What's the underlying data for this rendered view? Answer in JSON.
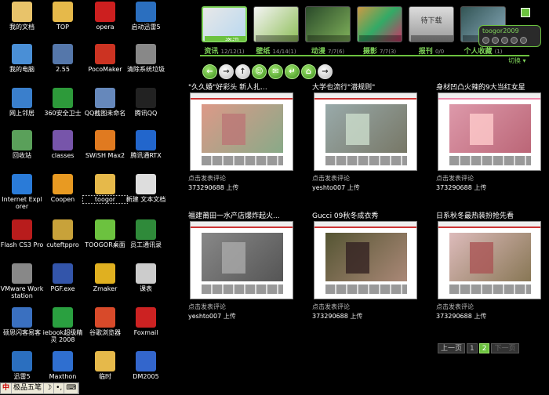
{
  "desktop": {
    "icons": [
      {
        "label": "我的文档",
        "icon": "my-documents-icon",
        "color": "#e8c36a"
      },
      {
        "label": "TOP",
        "icon": "folder-icon",
        "color": "#e6b94a"
      },
      {
        "label": "opera",
        "icon": "opera-icon",
        "color": "#cc1f1f"
      },
      {
        "label": "启动迅雷5",
        "icon": "thunder-icon",
        "color": "#2b6fbf"
      },
      {
        "label": "我的电脑",
        "icon": "my-computer-icon",
        "color": "#4a8fd6"
      },
      {
        "label": "2.55",
        "icon": "network-icon",
        "color": "#5577aa"
      },
      {
        "label": "PocoMaker",
        "icon": "pocomaker-icon",
        "color": "#cc3322"
      },
      {
        "label": "清除系统垃圾",
        "icon": "cleaner-icon",
        "color": "#888888"
      },
      {
        "label": "网上邻居",
        "icon": "network-places-icon",
        "color": "#3a7fcc"
      },
      {
        "label": "360安全卫士",
        "icon": "security-360-icon",
        "color": "#2d9a3a"
      },
      {
        "label": "QQ截图未命名",
        "icon": "qq-screenshot-icon",
        "color": "#6688bb"
      },
      {
        "label": "腾讯QQ",
        "icon": "qq-penguin-icon",
        "color": "#222222"
      },
      {
        "label": "回收站",
        "icon": "recycle-bin-icon",
        "color": "#5aa05a"
      },
      {
        "label": "classes",
        "icon": "archive-icon",
        "color": "#7755aa"
      },
      {
        "label": "SWiSH Max2",
        "icon": "swish-icon",
        "color": "#e07a20"
      },
      {
        "label": "腾讯通RTX",
        "icon": "rtx-icon",
        "color": "#2266cc"
      },
      {
        "label": "Internet Explorer",
        "icon": "ie-icon",
        "color": "#2a7bd8"
      },
      {
        "label": "Coopen",
        "icon": "coopen-icon",
        "color": "#e89a22"
      },
      {
        "label": "toogor",
        "icon": "folder-icon",
        "color": "#e6b94a"
      },
      {
        "label": "新建 文本文档",
        "icon": "text-file-icon",
        "color": "#dddddd"
      },
      {
        "label": "Flash CS3 Pro",
        "icon": "flash-icon",
        "color": "#b81c1c"
      },
      {
        "label": "cuteftppro",
        "icon": "ftp-icon",
        "color": "#c8a23a"
      },
      {
        "label": "TOOGOR桌面",
        "icon": "toogor-icon",
        "color": "#6cc23f"
      },
      {
        "label": "员工通讯录",
        "icon": "excel-icon",
        "color": "#2f8a3a"
      },
      {
        "label": "VMware Workstation",
        "icon": "vmware-icon",
        "color": "#888888"
      },
      {
        "label": "PGF.exe",
        "icon": "exe-icon",
        "color": "#3355aa"
      },
      {
        "label": "Zmaker",
        "icon": "zmaker-icon",
        "color": "#e0b020"
      },
      {
        "label": "课表",
        "icon": "document-icon",
        "color": "#cccccc"
      },
      {
        "label": "硕思闪客易客",
        "icon": "sothink-icon",
        "color": "#3a70c0"
      },
      {
        "label": "iebook超级精灵 2008",
        "icon": "iebook-icon",
        "color": "#2aa040"
      },
      {
        "label": "谷歌浏览器",
        "icon": "chrome-icon",
        "color": "#d84a2a"
      },
      {
        "label": "Foxmail",
        "icon": "foxmail-icon",
        "color": "#cc2222"
      },
      {
        "label": "迅雷5",
        "icon": "thunder-icon",
        "color": "#2b6fbf"
      },
      {
        "label": "Maxthon",
        "icon": "maxthon-icon",
        "color": "#2f6fd0"
      },
      {
        "label": "临时",
        "icon": "folder-icon",
        "color": "#e6b94a"
      },
      {
        "label": "DM2005",
        "icon": "dm-icon",
        "color": "#3366cc"
      }
    ]
  },
  "taskbar": {
    "ime_logo": "中",
    "ime_name": "极品五笔",
    "ime_moon": "☽",
    "ime_dot": "•,",
    "ime_kb": "⌨"
  },
  "widget": {
    "tabs": [
      {
        "name": "资讯",
        "count": "12/12(1)",
        "active": true
      },
      {
        "name": "壁纸",
        "count": "14/14(1)",
        "active": false
      },
      {
        "name": "动漫",
        "count": "7/7(6)",
        "active": false
      },
      {
        "name": "摄影",
        "count": "7/7(3)",
        "active": false
      },
      {
        "name": "报刊",
        "count": "0/0",
        "active": false,
        "thumb_text": "待下载"
      },
      {
        "name": "个人收藏",
        "count": "(1)",
        "active": false
      }
    ],
    "tab_thumb_caption": "资讯",
    "user": "toogor2009",
    "switch_label": "切换",
    "toolbar_buttons": [
      "←",
      "→",
      "↑",
      "☺",
      "✉",
      "↵",
      "⌂",
      "→"
    ],
    "items": [
      {
        "title": "\"久久婚\"好彩头  新人扎...",
        "comment": "点击发表评论",
        "uploader": "373290688",
        "upload_label": "上传"
      },
      {
        "title": "大学也流行\"潜规则\"",
        "comment": "点击发表评论",
        "uploader": "yeshto007",
        "upload_label": "上传"
      },
      {
        "title": "身材凹凸火辣的9大当红女星",
        "comment": "点击发表评论",
        "uploader": "373290688",
        "upload_label": "上传"
      },
      {
        "title": "福建莆田一水产店爆炸起火...",
        "comment": "点击发表评论",
        "uploader": "yeshto007",
        "upload_label": "上传"
      },
      {
        "title": "Gucci 09秋冬成衣秀",
        "comment": "点击发表评论",
        "uploader": "373290688",
        "upload_label": "上传"
      },
      {
        "title": "日系秋冬最热装扮抢先看",
        "comment": "点击发表评论",
        "uploader": "373290688",
        "upload_label": "上传"
      }
    ],
    "pager": {
      "prev": "上一页",
      "pages": [
        "1",
        "2"
      ],
      "current": "2",
      "next": "下一页"
    }
  }
}
